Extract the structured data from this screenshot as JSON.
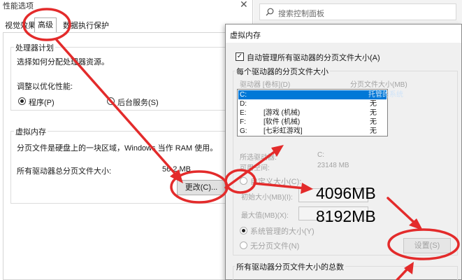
{
  "perf_dialog": {
    "title": "性能选项",
    "tabs": [
      "视觉效果",
      "高级",
      "数据执行保护"
    ],
    "cpu_group": {
      "legend": "处理器计划",
      "desc": "选择如何分配处理器资源。",
      "adjust_label": "调整以优化性能:",
      "options": [
        "程序(P)",
        "后台服务(S)"
      ],
      "selected_index": 0
    },
    "vm_group": {
      "legend": "虚拟内存",
      "desc": "分页文件是硬盘上的一块区域，Windows 当作 RAM 使用。",
      "total_label": "所有驱动器总分页文件大小:",
      "total_value": "56  2 MB",
      "change_button": "更改(C)..."
    }
  },
  "control_panel": {
    "search_placeholder": "搜索控制面板",
    "search_icon": "search-icon"
  },
  "vm_dialog": {
    "title": "虚拟内存",
    "auto_manage_label": "自动管理所有驱动器的分页文件大小(A)",
    "auto_manage_checked": true,
    "per_drive_legend": "每个驱动器的分页文件大小",
    "columns": [
      "驱动器 [卷标](D)",
      "分页文件大小(MB)"
    ],
    "drives": [
      {
        "drive": "C:",
        "label": "",
        "size": "托管的系统"
      },
      {
        "drive": "D:",
        "label": "",
        "size": "无"
      },
      {
        "drive": "E:",
        "label": "[游戏 (机械)",
        "size": "无"
      },
      {
        "drive": "F:",
        "label": "[软件 (机械)",
        "size": "无"
      },
      {
        "drive": "G:",
        "label": "[七彩虹游戏]",
        "size": "无"
      }
    ],
    "selected_drive_label": "所选驱动器:",
    "selected_drive_value": "C:",
    "free_space_label": "可用空间:",
    "free_space_value": "23148 MB",
    "custom_size_label": "自定义大小(C):",
    "initial_size_label": "初始大小(MB)(I):",
    "max_size_label": "最大值(MB)(X):",
    "system_managed_label": "系统管理的大小(Y)",
    "no_paging_label": "无分页文件(N)",
    "set_button": "设置(S)",
    "total_legend": "所有驱动器分页文件大小的总数"
  },
  "annotations": {
    "initial_size": "4096MB",
    "max_size": "8192MB",
    "color": "#e32b2b"
  }
}
